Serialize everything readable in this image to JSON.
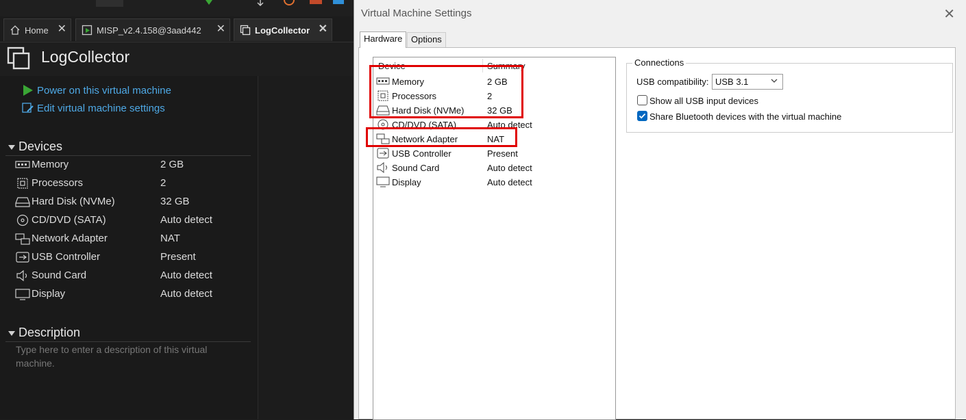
{
  "tabs": [
    {
      "label": "Home",
      "icon": "home-icon"
    },
    {
      "label": "MISP_v2.4.158@3aad442",
      "icon": "vm-running-icon"
    },
    {
      "label": "LogCollector",
      "icon": "vm-icon"
    }
  ],
  "vm": {
    "title": "LogCollector",
    "actions": {
      "power_on": "Power on this virtual machine",
      "edit_settings": "Edit virtual machine settings"
    },
    "devices_heading": "Devices",
    "devices": [
      {
        "name": "Memory",
        "value": "2 GB",
        "icon": "memory-icon"
      },
      {
        "name": "Processors",
        "value": "2",
        "icon": "processor-icon"
      },
      {
        "name": "Hard Disk (NVMe)",
        "value": "32 GB",
        "icon": "hard-disk-icon"
      },
      {
        "name": "CD/DVD (SATA)",
        "value": "Auto detect",
        "icon": "cd-dvd-icon"
      },
      {
        "name": "Network Adapter",
        "value": "NAT",
        "icon": "network-icon"
      },
      {
        "name": "USB Controller",
        "value": "Present",
        "icon": "usb-icon"
      },
      {
        "name": "Sound Card",
        "value": "Auto detect",
        "icon": "speaker-icon"
      },
      {
        "name": "Display",
        "value": "Auto detect",
        "icon": "monitor-icon"
      }
    ],
    "description_heading": "Description",
    "description_placeholder": "Type here to enter a description of this virtual machine."
  },
  "dialog": {
    "title": "Virtual Machine Settings",
    "tabs": [
      "Hardware",
      "Options"
    ],
    "columns": {
      "device": "Device",
      "summary": "Summary"
    },
    "devices": [
      {
        "name": "Memory",
        "summary": "2 GB"
      },
      {
        "name": "Processors",
        "summary": "2"
      },
      {
        "name": "Hard Disk (NVMe)",
        "summary": "32 GB"
      },
      {
        "name": "CD/DVD (SATA)",
        "summary": "Auto detect"
      },
      {
        "name": "Network Adapter",
        "summary": "NAT"
      },
      {
        "name": "USB Controller",
        "summary": "Present"
      },
      {
        "name": "Sound Card",
        "summary": "Auto detect"
      },
      {
        "name": "Display",
        "summary": "Auto detect"
      }
    ],
    "connections": {
      "title": "Connections",
      "usb_compat_label": "USB compatibility:",
      "usb_compat_value": "USB 3.1",
      "show_all_usb_label": "Show all USB input devices",
      "show_all_usb_checked": false,
      "share_bt_label": "Share Bluetooth devices with the virtual machine",
      "share_bt_checked": true
    }
  },
  "colors": {
    "accent_link": "#4ea9e6",
    "play_green": "#3aa635",
    "highlight_red": "#e00000",
    "checkbox_blue": "#0067c0"
  }
}
